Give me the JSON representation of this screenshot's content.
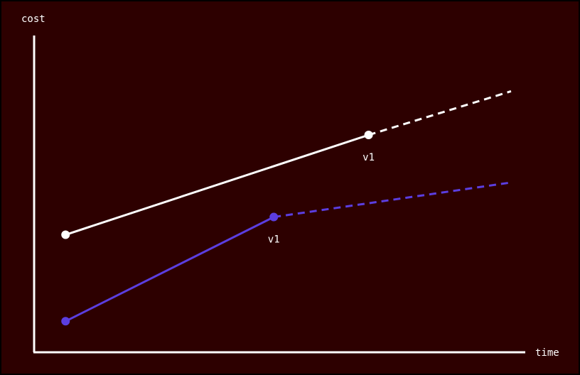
{
  "chart_data": {
    "type": "line",
    "xlabel": "time",
    "ylabel": "cost",
    "xlim": [
      0,
      10
    ],
    "ylim": [
      0,
      10
    ],
    "grid": false,
    "legend": "none",
    "series": [
      {
        "color": "#ffffff",
        "solid": [
          {
            "x": 0.64,
            "y": 3.71
          },
          {
            "x": 6.81,
            "y": 6.86
          }
        ],
        "dashed": [
          {
            "x": 6.81,
            "y": 6.86
          },
          {
            "x": 9.71,
            "y": 8.24
          }
        ],
        "points": [
          {
            "x": 0.64,
            "y": 3.71
          },
          {
            "x": 6.81,
            "y": 6.86,
            "label": "v1"
          }
        ]
      },
      {
        "color": "#5b3ee0",
        "solid": [
          {
            "x": 0.64,
            "y": 0.98
          },
          {
            "x": 4.88,
            "y": 4.27
          }
        ],
        "dashed": [
          {
            "x": 4.88,
            "y": 4.27
          },
          {
            "x": 9.71,
            "y": 5.36
          }
        ],
        "points": [
          {
            "x": 0.64,
            "y": 0.98
          },
          {
            "x": 4.88,
            "y": 4.27,
            "label": "v1"
          }
        ]
      }
    ]
  },
  "colors": {
    "background": "#2d0000",
    "axis": "#ffffff"
  }
}
